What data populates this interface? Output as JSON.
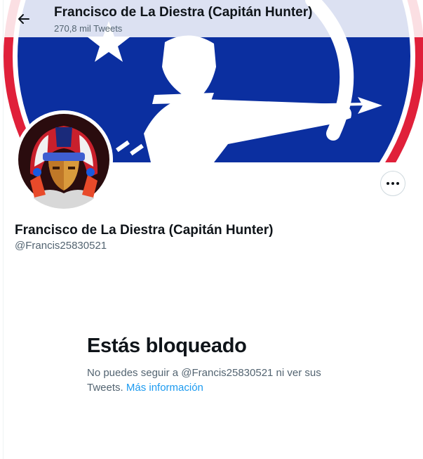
{
  "header": {
    "title": "Francisco de La Diestra (Capitán Hunter)",
    "tweet_count": "270,8 mil Tweets"
  },
  "profile": {
    "display_name": "Francisco de La Diestra (Capitán Hunter)",
    "handle": "@Francis25830521"
  },
  "blocked": {
    "title": "Estás bloqueado",
    "message": "No puedes seguir a @Francis25830521 ni ver sus Tweets.",
    "link": "Más información"
  },
  "icons": {
    "back": "arrow-left-icon",
    "more": "more-horizontal-icon"
  },
  "colors": {
    "link": "#1d9bf0",
    "secondary_text": "#536471",
    "banner_blue": "#0b2fa0",
    "banner_red": "#e0203a"
  }
}
